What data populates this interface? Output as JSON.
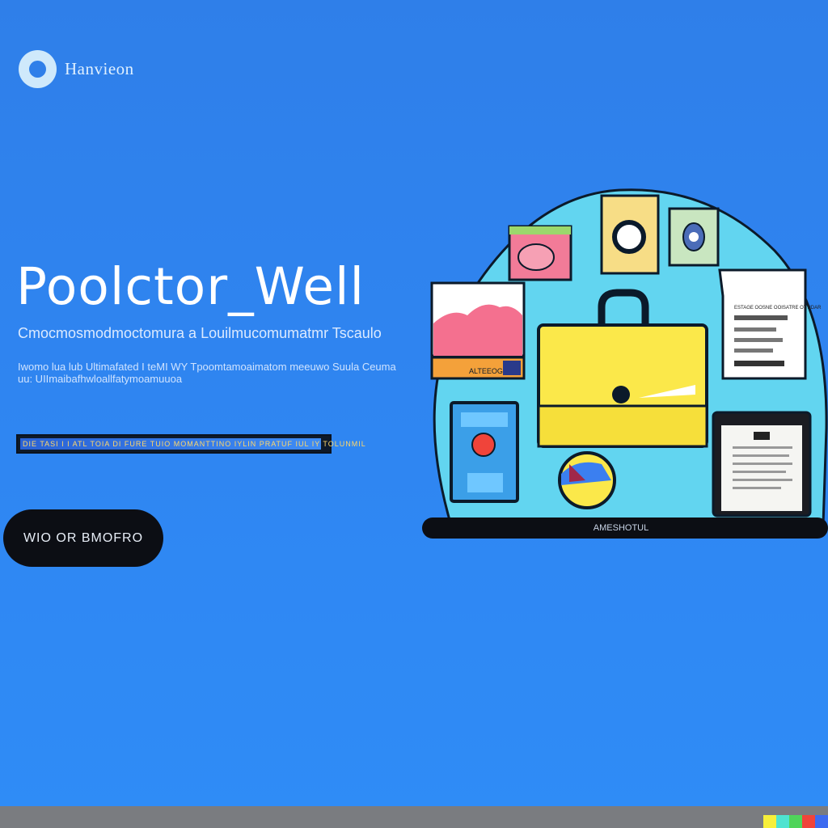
{
  "brand": {
    "name": "Hanvieon"
  },
  "hero": {
    "title": "Poolctor_Well",
    "subtitle": "Cmocmosmodmoctomura a Louilmucomumatmr Tscaulo",
    "body": "Iwomo lua lub Ultimafated I teMI WY Tpoomtamoaimatom meeuwo Suula Ceuma uu: UIImaibafhwloallfatymoamuuoa",
    "progress_text": "DIE TASI I I ATL TOIA DI FURE TUIO MOMANTTINO IYLIN PRATUF IUL IY TOLUNMIL",
    "progress": 0.98,
    "cta_label": "WIO OR BMOFRO"
  },
  "illustration": {
    "card_text": "ESTAGE OOSNE OOISATRE OTTIDAR",
    "laptop_label": "AMESHOTUL",
    "small_card_label": "ALTEEOG"
  },
  "footer": {
    "swatches": [
      "#f7ef3a",
      "#4ee3d0",
      "#4fd45a",
      "#f0443a",
      "#3d6bf0"
    ]
  }
}
